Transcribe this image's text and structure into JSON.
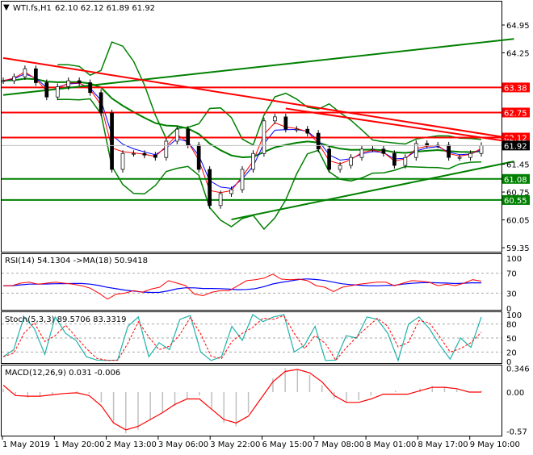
{
  "header": {
    "symbol_label": "WTI.fs,H1",
    "ohlc": "62.10 62.12 61.89 61.92"
  },
  "colors": {
    "support": "#008000",
    "resistance": "#ff0000",
    "current": "#000000",
    "rsi": "#ff0000",
    "rsi_ma": "#0000ff",
    "stoch_main": "#20b2aa",
    "stoch_signal": "#ff0000",
    "macd_hist": "#c0c0c0",
    "macd_signal": "#ff0000"
  },
  "chart_data": [
    {
      "type": "line",
      "title": "WTI.fs,H1",
      "price_axis": {
        "ticks": [
          "64.95",
          "64.25",
          "61.45",
          "60.75",
          "60.05",
          "59.35"
        ],
        "ylim": [
          59.35,
          64.95
        ]
      },
      "x_labels": [
        "1 May 2019",
        "1 May 20:00",
        "2 May 13:00",
        "3 May 06:00",
        "3 May 22:00",
        "6 May 15:00",
        "7 May 08:00",
        "8 May 01:00",
        "8 May 17:00",
        "9 May 10:00"
      ],
      "close": [
        63.55,
        63.65,
        63.85,
        63.5,
        63.14,
        63.4,
        63.55,
        63.5,
        63.25,
        62.74,
        61.32,
        61.72,
        61.72,
        61.68,
        61.62,
        62.03,
        62.33,
        61.93,
        61.32,
        60.41,
        60.71,
        60.81,
        61.32,
        61.72,
        62.54,
        62.64,
        62.33,
        62.33,
        62.23,
        61.83,
        61.32,
        61.42,
        61.62,
        61.83,
        61.83,
        61.72,
        61.42,
        61.62,
        61.97,
        61.93,
        61.93,
        61.62,
        61.62,
        61.72,
        61.92
      ],
      "levels": [
        {
          "label": "63.38",
          "value": 63.38,
          "kind": "resistance"
        },
        {
          "label": "62.75",
          "value": 62.75,
          "kind": "resistance"
        },
        {
          "label": "62.12",
          "value": 62.12,
          "kind": "resistance"
        },
        {
          "label": "61.08",
          "value": 61.08,
          "kind": "support"
        },
        {
          "label": "60.55",
          "value": 60.55,
          "kind": "support"
        }
      ],
      "current_price": {
        "label": "61.92",
        "value": 61.92
      },
      "trendlines": [
        {
          "kind": "support",
          "from": [
            0,
            63.19
          ],
          "to": [
            47,
            64.6
          ]
        },
        {
          "kind": "support",
          "from": [
            21,
            60.06
          ],
          "to": [
            47,
            61.52
          ]
        },
        {
          "kind": "resistance",
          "from": [
            0,
            64.12
          ],
          "to": [
            47,
            62.09
          ]
        },
        {
          "kind": "resistance",
          "from": [
            26,
            62.85
          ],
          "to": [
            47,
            62.0
          ]
        }
      ]
    },
    {
      "type": "line",
      "title": "RSI(14) 54.1304 ->MA(18) 50.9418",
      "ticks": [
        "100",
        "70",
        "30",
        "0"
      ],
      "ylim": [
        0,
        100
      ],
      "rsi": [
        45,
        45,
        50,
        52,
        48,
        50,
        52,
        50,
        48,
        45,
        40,
        30,
        18,
        28,
        30,
        35,
        32,
        38,
        42,
        55,
        50,
        45,
        28,
        25,
        32,
        35,
        35,
        45,
        55,
        57,
        60,
        68,
        58,
        57,
        58,
        55,
        45,
        42,
        33,
        42,
        45,
        48,
        50,
        52,
        52,
        45,
        50,
        55,
        54,
        52,
        45,
        48,
        45,
        50,
        57,
        54
      ]
    },
    {
      "type": "line",
      "title": "Stoch(5,3,3) 89.5706 83.3319",
      "ticks": [
        "100",
        "80",
        "50",
        "20",
        "0"
      ],
      "ylim": [
        0,
        100
      ],
      "main": [
        10,
        25,
        95,
        70,
        15,
        95,
        60,
        45,
        10,
        3,
        2,
        3,
        75,
        95,
        10,
        40,
        25,
        90,
        98,
        20,
        2,
        10,
        75,
        45,
        100,
        85,
        95,
        100,
        20,
        35,
        75,
        2,
        3,
        55,
        50,
        95,
        90,
        60,
        2,
        80,
        95,
        70,
        35,
        5,
        50,
        30,
        95
      ]
    },
    {
      "type": "bar",
      "title": "MACD(12,26,9) 0.031 -0.006",
      "ticks": [
        "0.346",
        "0.00",
        "-0.57"
      ],
      "ylim": [
        -0.6,
        0.4
      ],
      "histogram": [
        0.05,
        -0.05,
        -0.08,
        -0.06,
        -0.03,
        0.0,
        0.01,
        -0.02,
        -0.15,
        -0.45,
        -0.6,
        -0.55,
        -0.4,
        -0.3,
        -0.2,
        -0.1,
        -0.05,
        -0.25,
        -0.45,
        -0.5,
        -0.3,
        0.0,
        0.2,
        0.35,
        0.33,
        0.25,
        0.1,
        -0.1,
        -0.15,
        -0.12,
        -0.05,
        0.0,
        0.02,
        0.0,
        0.05,
        0.09,
        0.08,
        0.04,
        0.01,
        0.02
      ],
      "signal": [
        0.1,
        -0.05,
        -0.06,
        -0.06,
        -0.04,
        -0.02,
        -0.01,
        -0.05,
        -0.2,
        -0.45,
        -0.55,
        -0.5,
        -0.4,
        -0.3,
        -0.18,
        -0.1,
        -0.1,
        -0.25,
        -0.4,
        -0.45,
        -0.35,
        -0.1,
        0.15,
        0.3,
        0.33,
        0.28,
        0.15,
        -0.05,
        -0.15,
        -0.15,
        -0.1,
        -0.03,
        -0.03,
        -0.03,
        0.02,
        0.07,
        0.07,
        0.05,
        0.0,
        0.0
      ]
    }
  ]
}
